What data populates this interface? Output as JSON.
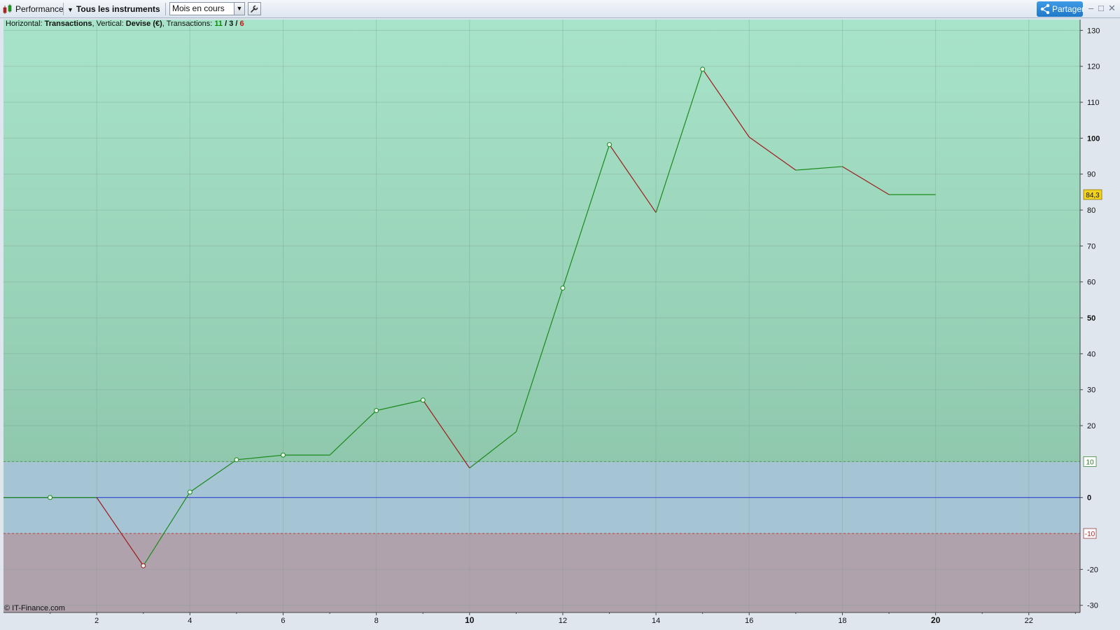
{
  "toolbar": {
    "performance_label": "Performance",
    "instruments_label": "Tous les instruments",
    "period_value": "Mois en cours",
    "share_label": "Partager",
    "window_controls": [
      "–",
      "□",
      "✕"
    ]
  },
  "legend": {
    "horizontal_label": "Horizontal: ",
    "horizontal_value": "Transactions",
    "vertical_label": ", Vertical: ",
    "vertical_value": "Devise (€)",
    "transactions_label": ", Transactions: ",
    "tx_winning": "11",
    "tx_sep1": " / ",
    "tx_neutral": "3",
    "tx_sep2": " / ",
    "tx_losing": "6"
  },
  "copyright": "© IT-Finance.com",
  "colors": {
    "up": "#1a8a1a",
    "down": "#9e1c1c",
    "zero_line": "#2233cc",
    "zone_green": "#9fd9bd",
    "zone_blue": "#a5c4d4",
    "zone_red": "#b0a2ad",
    "last_badge": "#f2d21a"
  },
  "chart_data": {
    "type": "line",
    "title": "",
    "xlabel": "",
    "ylabel": "",
    "xlim": [
      0,
      23.1
    ],
    "ylim": [
      -32,
      133
    ],
    "x_ticks": [
      2,
      4,
      6,
      8,
      10,
      12,
      14,
      16,
      18,
      20,
      22
    ],
    "x_ticks_bold": [
      10,
      20
    ],
    "y_ticks": [
      -30,
      -20,
      0,
      20,
      30,
      40,
      50,
      60,
      70,
      80,
      90,
      100,
      110,
      120,
      130
    ],
    "y_ticks_bold": [
      0,
      50,
      100
    ],
    "zone_upper": 10,
    "zone_lower": -10,
    "zone_upper_label": "10",
    "zone_lower_label": "-10",
    "last_value": 84.3,
    "last_value_label": "84,3",
    "grid": true,
    "series": [
      {
        "x": [
          0,
          1,
          2,
          3,
          4,
          5,
          6,
          7,
          8,
          9,
          10,
          11,
          12,
          13,
          14,
          15,
          16,
          17,
          18,
          19,
          20
        ],
        "y": [
          0,
          0,
          0,
          -19,
          1.5,
          10.5,
          11.8,
          11.8,
          24.2,
          27.1,
          8.2,
          18.3,
          58.3,
          98.2,
          79.3,
          119.2,
          100.3,
          91.1,
          92.1,
          84.3,
          84.3
        ],
        "markers": [
          1,
          3,
          4,
          5,
          6,
          8,
          9,
          12,
          13,
          15
        ]
      }
    ]
  }
}
